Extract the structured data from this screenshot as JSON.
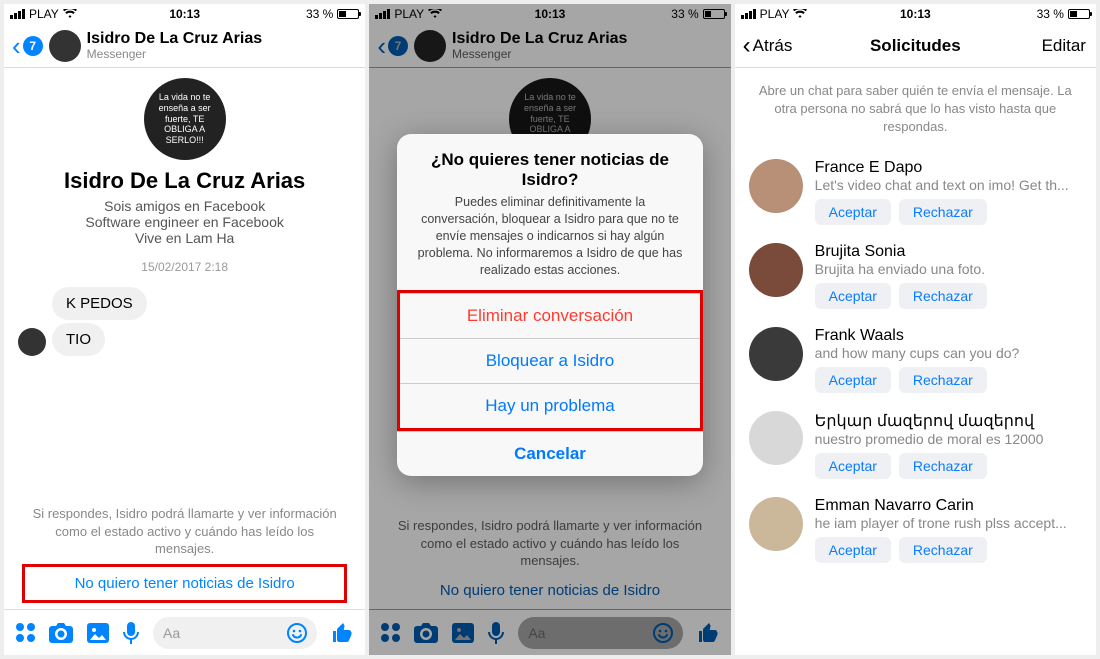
{
  "status": {
    "carrier": "PLAY",
    "time": "10:13",
    "battery_pct": "33 %"
  },
  "contact": {
    "name": "Isidro De La Cruz Arias",
    "app": "Messenger",
    "badge": "7",
    "avatar_text": "La vida no te enseña a ser fuerte, TE OBLIGA A SERLO!!!"
  },
  "profile": {
    "name": "Isidro De La Cruz Arias",
    "friends_line": "Sois amigos en Facebook",
    "job_line": "Software engineer en Facebook",
    "lives_line": "Vive en Lam Ha"
  },
  "chat": {
    "timestamp": "15/02/2017 2:18",
    "messages": [
      {
        "text": "K PEDOS"
      },
      {
        "text": "TIO"
      }
    ],
    "warning_text": "Si respondes, Isidro podrá llamarte y ver información como el estado activo y cuándo has leído los mensajes.",
    "dont_want_link": "No quiero tener noticias de Isidro",
    "input_placeholder": "Aa"
  },
  "alert": {
    "title": "¿No quieres tener noticias de Isidro?",
    "message": "Puedes eliminar definitivamente la conversación, bloquear a Isidro para que no te envíe mensajes o indicarnos si hay algún problema. No informaremos a Isidro de que has realizado estas acciones.",
    "delete": "Eliminar conversación",
    "block": "Bloquear a Isidro",
    "report": "Hay un problema",
    "cancel": "Cancelar"
  },
  "solicitudes": {
    "back": "Atrás",
    "title": "Solicitudes",
    "edit": "Editar",
    "help": "Abre un chat para saber quién te envía el mensaje. La otra persona no sabrá que lo has visto hasta que respondas.",
    "accept": "Aceptar",
    "reject": "Rechazar",
    "requests": [
      {
        "name": "France E Dapo",
        "preview": "Let's video chat and text on imo! Get th..."
      },
      {
        "name": "Brujita Sonia",
        "preview": "Brujita ha enviado una foto."
      },
      {
        "name": "Frank Waals",
        "preview": "and how many cups can you do?"
      },
      {
        "name": "Երկար մազերով մազերով",
        "preview": "nuestro promedio de moral es 12000"
      },
      {
        "name": "Emman Navarro Carin",
        "preview": "he iam player of trone rush plss accept..."
      }
    ]
  },
  "avatar_colors": [
    "#b89078",
    "#7a4a3a",
    "#3a3a3a",
    "#d8d8d8",
    "#cbb89a"
  ]
}
